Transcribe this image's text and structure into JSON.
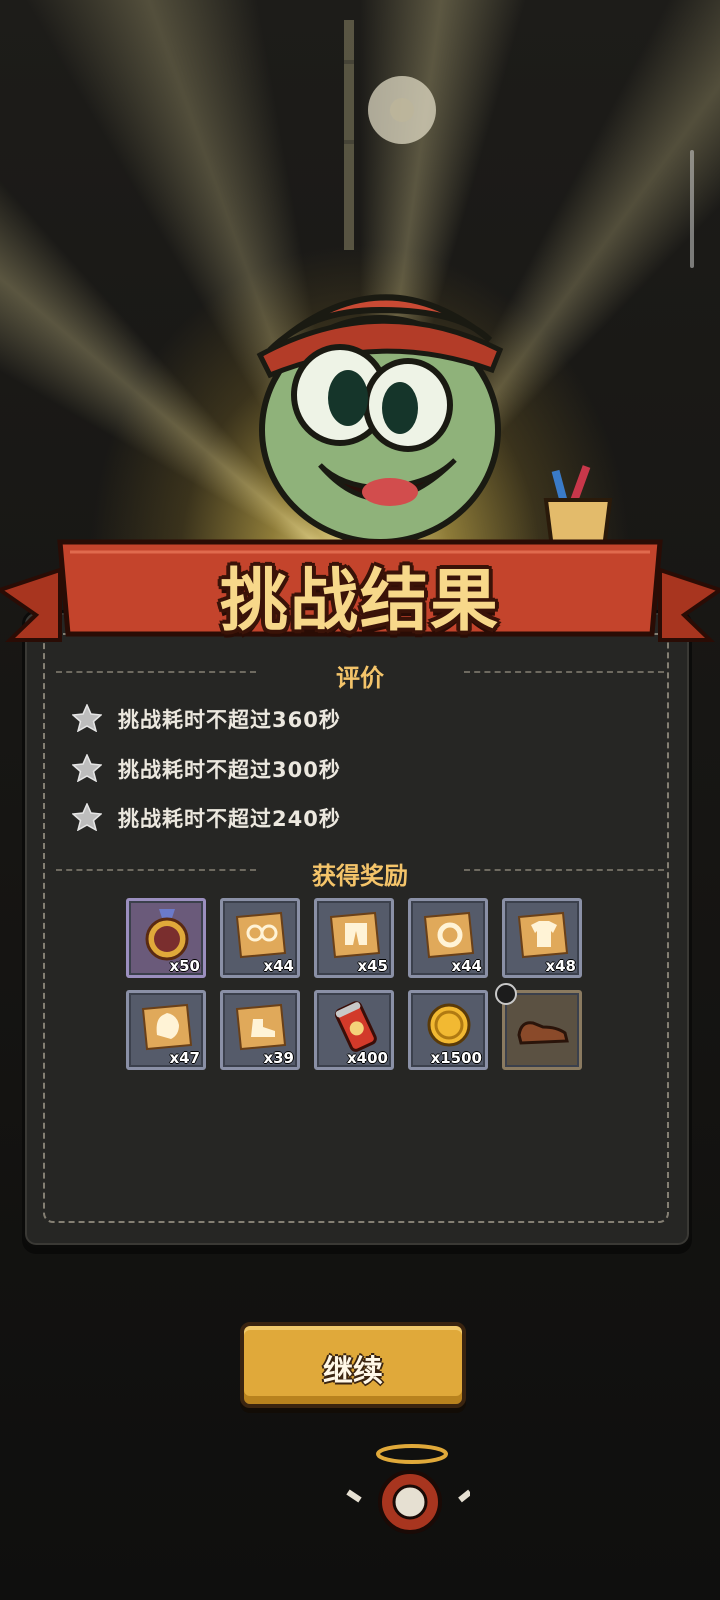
{
  "title": "挑战结果",
  "evaluation": {
    "header": "评价",
    "requirements": [
      {
        "text": "挑战耗时不超过360秒",
        "achieved": false
      },
      {
        "text": "挑战耗时不超过300秒",
        "achieved": false
      },
      {
        "text": "挑战耗时不超过240秒",
        "achieved": false
      }
    ]
  },
  "rewards": {
    "header": "获得奖励",
    "items": [
      {
        "icon": "exp-medal-icon",
        "qty": "x50"
      },
      {
        "icon": "blueprint-glasses-icon",
        "qty": "x44"
      },
      {
        "icon": "blueprint-pants-icon",
        "qty": "x45"
      },
      {
        "icon": "blueprint-ring-icon",
        "qty": "x44"
      },
      {
        "icon": "blueprint-shirt-icon",
        "qty": "x48"
      },
      {
        "icon": "blueprint-glove-icon",
        "qty": "x47"
      },
      {
        "icon": "blueprint-shoe-icon",
        "qty": "x39"
      },
      {
        "icon": "soda-can-icon",
        "qty": "x400"
      },
      {
        "icon": "gold-coin-icon",
        "qty": "x1500"
      },
      {
        "icon": "brown-shoe-icon",
        "qty": ""
      }
    ]
  },
  "continue_button": "继续",
  "colors": {
    "banner": "#c4442c",
    "title": "#f7d88a",
    "header": "#f4c46a",
    "button": "#e0a93a"
  }
}
